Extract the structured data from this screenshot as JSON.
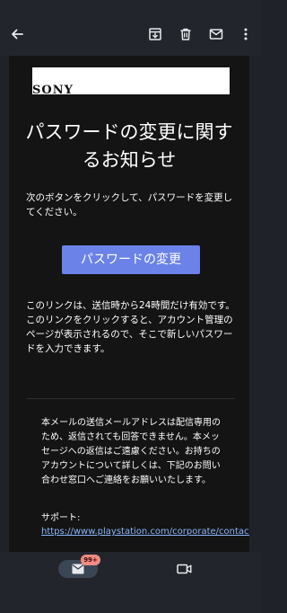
{
  "email": {
    "brand_logo": "SONY",
    "headline": "パスワードの変更に関するお知らせ",
    "intro": "次のボタンをクリックして、パスワードを変更してください。",
    "cta_label": "パスワードの変更",
    "link_info": "このリンクは、送信時から24時間だけ有効です。このリンクをクリックすると、アカウント管理のページが表示されるので、そこで新しいパスワードを入力できます。",
    "footer_note": "本メールの送信メールアドレスは配信専用のため、返信されても回答できません。本メッセージへの返信はご遠慮ください。お持ちのアカウントについて詳しくは、下記のお問い合わせ窓口へご連絡をお願いいたします。",
    "support_label": "サポート:",
    "support_url": "https://www.playstation.com/corporate/contactus/"
  },
  "bottom_nav": {
    "mail_badge": "99+"
  },
  "icons": {
    "back": "arrow-back-icon",
    "archive": "archive-icon",
    "delete": "trash-icon",
    "mark_unread": "mail-icon",
    "more": "more-vert-icon",
    "nav_mail": "mail-icon",
    "nav_meet": "video-camera-icon"
  },
  "colors": {
    "bar_background": "#22262c",
    "email_background": "#141414",
    "button": "#6b82e8",
    "link": "#8ab4f8",
    "badge": "#f28b82"
  }
}
